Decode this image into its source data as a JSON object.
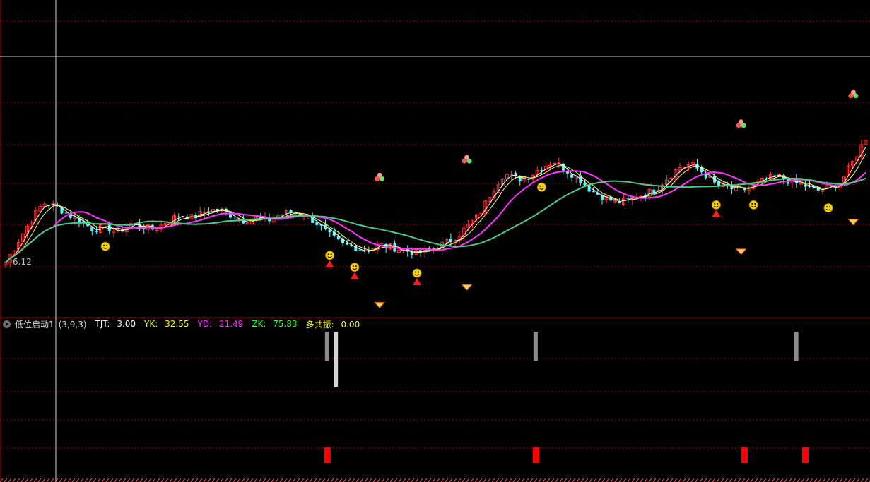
{
  "price_label": "6.12",
  "indicator": {
    "name": "低位启动1",
    "params": "(3,9,3)",
    "items": [
      {
        "label": "TJT:",
        "value": "3.00",
        "color": "#ffffff"
      },
      {
        "label": "YK:",
        "value": "32.55",
        "color": "#ffff00"
      },
      {
        "label": "YD:",
        "value": "21.49",
        "color": "#ff00ff"
      },
      {
        "label": "ZK:",
        "value": "75.83",
        "color": "#00ff00"
      },
      {
        "label": "多共振:",
        "value": "0.00",
        "color": "#ffff00"
      }
    ]
  },
  "colors": {
    "up": "#ff3333",
    "down": "#54ffff",
    "ma_pink": "#ff33ff",
    "ma_green": "#4ccc88",
    "ma_white": "#ffffff",
    "ma_yellow": "#ffff66",
    "grid": "#a00000"
  },
  "chart_data": {
    "type": "candlestick",
    "price_anchor": 6.12,
    "closes": [
      6.1,
      6.45,
      6.8,
      7.1,
      7.05,
      6.9,
      6.8,
      6.65,
      6.7,
      6.6,
      6.75,
      6.7,
      6.65,
      6.8,
      6.9,
      6.85,
      6.95,
      7.0,
      6.9,
      6.8,
      6.85,
      6.8,
      6.9,
      6.95,
      6.9,
      6.75,
      6.55,
      6.4,
      6.35,
      6.3,
      6.4,
      6.35,
      6.3,
      6.25,
      6.3,
      6.4,
      6.5,
      6.7,
      6.9,
      7.3,
      7.6,
      7.5,
      7.55,
      7.7,
      7.8,
      7.65,
      7.5,
      7.3,
      7.2,
      7.1,
      7.15,
      7.25,
      7.3,
      7.5,
      7.7,
      7.75,
      7.6,
      7.4,
      7.35,
      7.3,
      7.4,
      7.5,
      7.55,
      7.45,
      7.4,
      7.3,
      7.35,
      7.45,
      7.8,
      8.2
    ],
    "events": {
      "smiley_idx": [
        8,
        26,
        28,
        33,
        43,
        57,
        60,
        66
      ],
      "red_arrow_idx": [
        26,
        28,
        33,
        57
      ],
      "diamond_idx": [
        30,
        37,
        59,
        68
      ],
      "balls_idx": [
        30,
        37,
        59,
        68
      ]
    },
    "lower_panel": {
      "gray_bar_idx": [
        37,
        38,
        61,
        91
      ],
      "red_bar_idx": [
        37,
        61,
        85,
        92
      ]
    }
  }
}
